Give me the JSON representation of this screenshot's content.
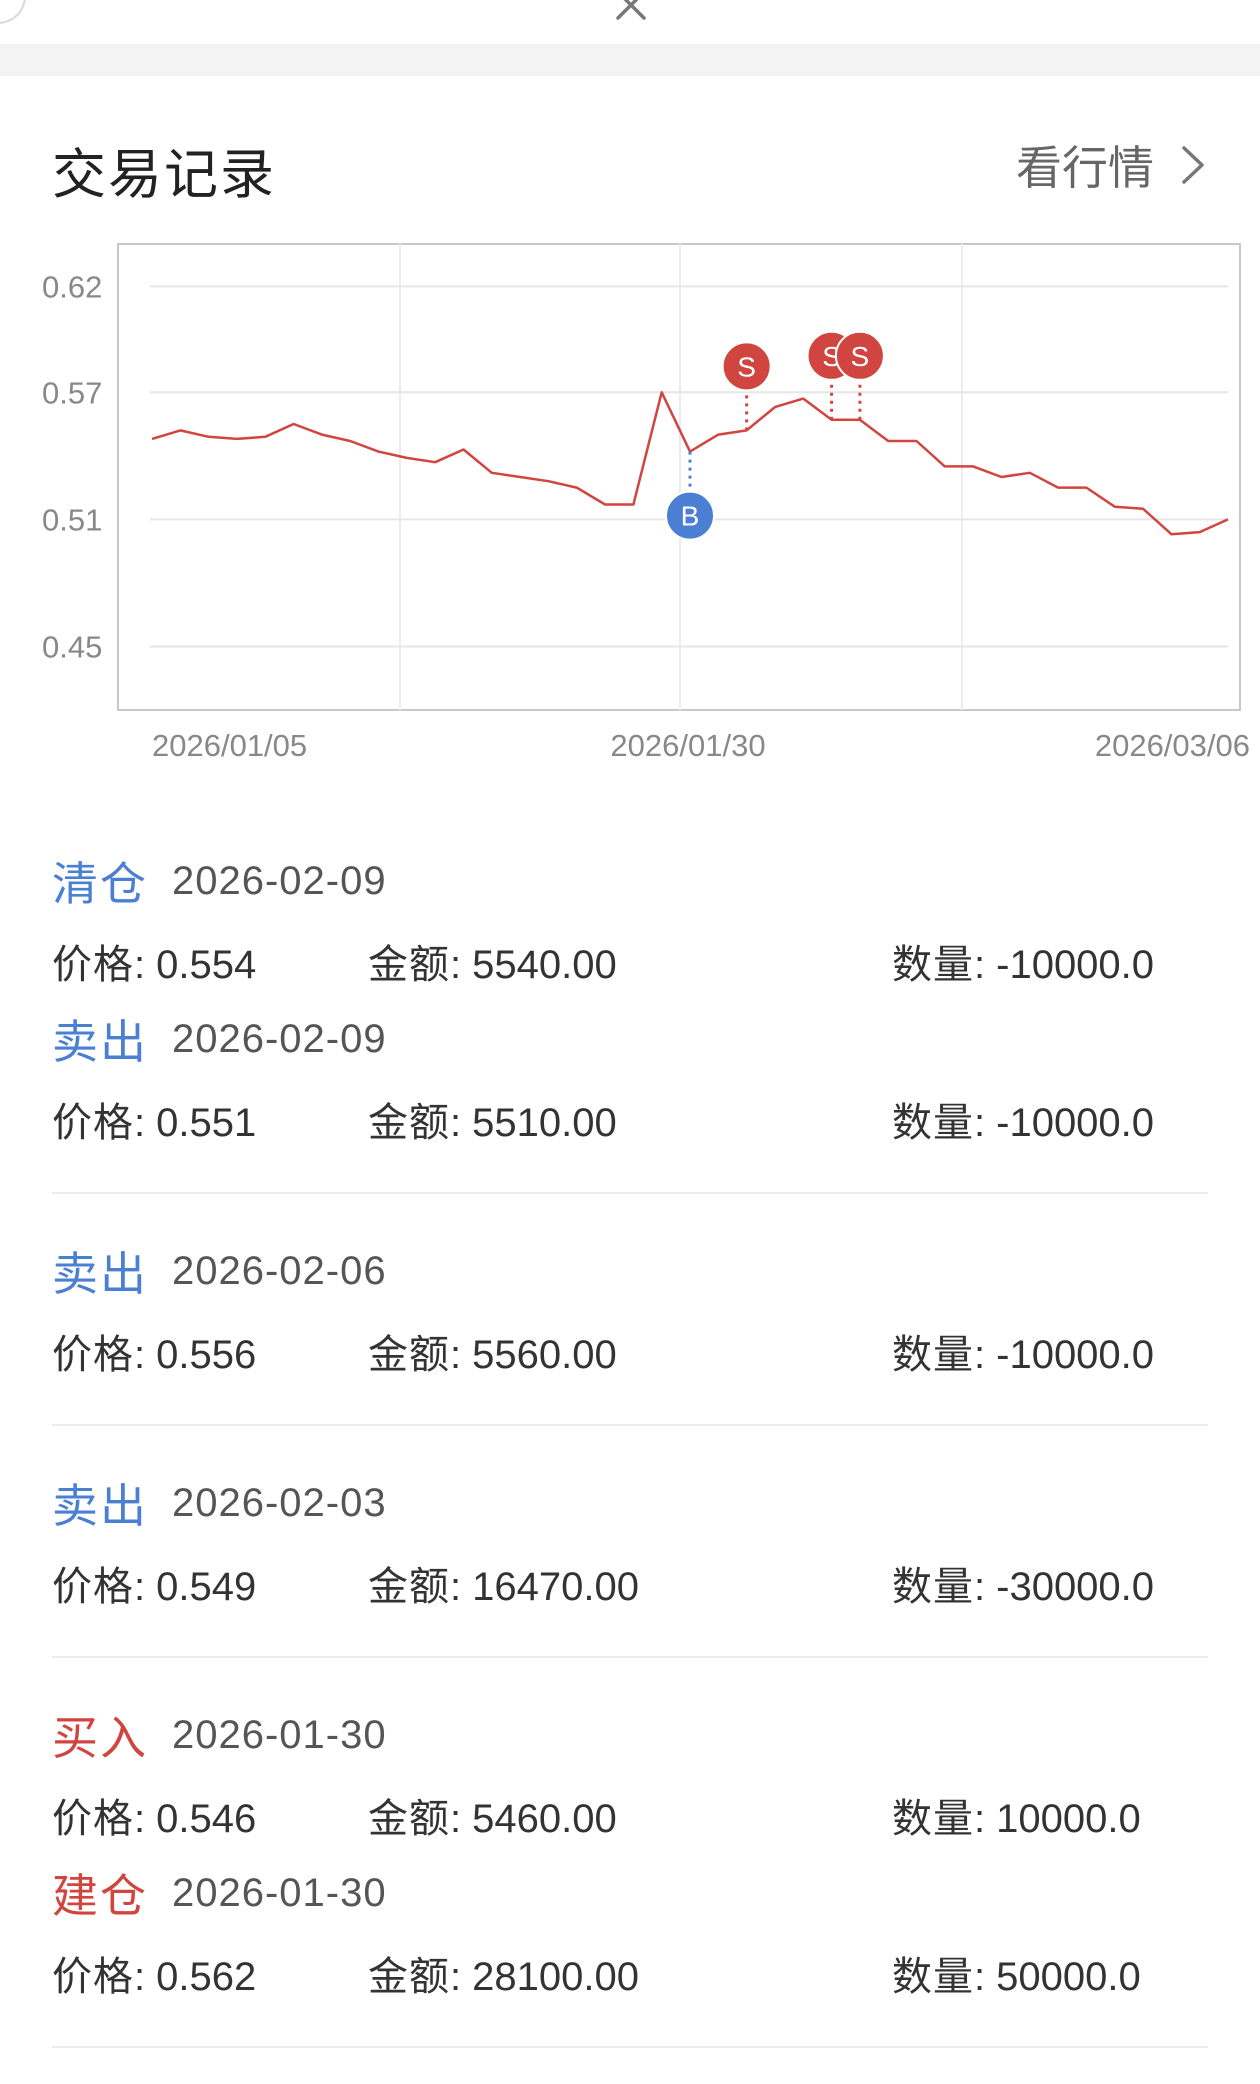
{
  "header": {
    "title": "交易记录",
    "market_link": "看行情"
  },
  "chart_data": {
    "type": "line",
    "y_ticks": [
      "0.62",
      "0.57",
      "0.51",
      "0.45"
    ],
    "x_ticks": [
      "2026/01/05",
      "2026/01/30",
      "2026/03/06"
    ],
    "ylim": [
      0.42,
      0.64
    ],
    "grid": true,
    "line_color": "#d0453f",
    "series": [
      {
        "values": [
          0.548,
          0.552,
          0.549,
          0.548,
          0.549,
          0.555,
          0.55,
          0.547,
          0.542,
          0.539,
          0.537,
          0.543,
          0.532,
          0.53,
          0.528,
          0.525,
          0.517,
          0.517,
          0.57,
          0.542,
          0.55,
          0.552,
          0.563,
          0.567,
          0.557,
          0.557,
          0.547,
          0.547,
          0.535,
          0.535,
          0.53,
          0.532,
          0.525,
          0.525,
          0.516,
          0.515,
          0.503,
          0.504,
          0.51
        ]
      }
    ],
    "markers": [
      {
        "label": "B",
        "index": 19,
        "color": "#4a7fd4"
      },
      {
        "label": "S",
        "index": 21,
        "color": "#d0453f"
      },
      {
        "label": "S",
        "index": 24,
        "color": "#d0453f"
      },
      {
        "label": "S",
        "index": 25,
        "color": "#d0453f"
      }
    ]
  },
  "records": [
    {
      "type": "清仓",
      "color": "blue",
      "date": "2026-02-09",
      "price_label": "价格:",
      "price": "0.554",
      "amount_label": "金额:",
      "amount": "5540.00",
      "qty_label": "数量:",
      "qty": "-10000.0"
    },
    {
      "type": "卖出",
      "color": "blue",
      "date": "2026-02-09",
      "price_label": "价格:",
      "price": "0.551",
      "amount_label": "金额:",
      "amount": "5510.00",
      "qty_label": "数量:",
      "qty": "-10000.0"
    },
    {
      "type": "卖出",
      "color": "blue",
      "date": "2026-02-06",
      "price_label": "价格:",
      "price": "0.556",
      "amount_label": "金额:",
      "amount": "5560.00",
      "qty_label": "数量:",
      "qty": "-10000.0"
    },
    {
      "type": "卖出",
      "color": "blue",
      "date": "2026-02-03",
      "price_label": "价格:",
      "price": "0.549",
      "amount_label": "金额:",
      "amount": "16470.00",
      "qty_label": "数量:",
      "qty": "-30000.0"
    },
    {
      "type": "买入",
      "color": "red",
      "date": "2026-01-30",
      "price_label": "价格:",
      "price": "0.546",
      "amount_label": "金额:",
      "amount": "5460.00",
      "qty_label": "数量:",
      "qty": "10000.0"
    },
    {
      "type": "建仓",
      "color": "red",
      "date": "2026-01-30",
      "price_label": "价格:",
      "price": "0.562",
      "amount_label": "金额:",
      "amount": "28100.00",
      "qty_label": "数量:",
      "qty": "50000.0"
    }
  ]
}
